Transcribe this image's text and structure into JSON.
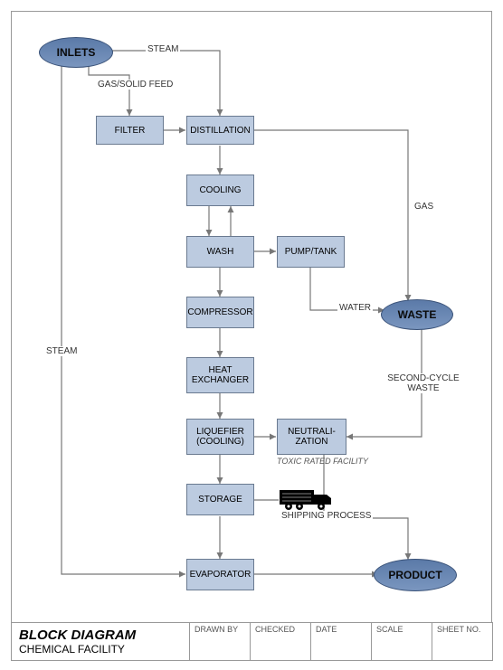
{
  "title": {
    "main": "BLOCK DIAGRAM",
    "sub": "CHEMICAL FACILITY"
  },
  "footer": {
    "drawn": "DRAWN BY",
    "checked": "CHECKED",
    "date": "DATE",
    "scale": "SCALE",
    "sheet": "SHEET NO."
  },
  "nodes": {
    "inlets": "INLETS",
    "filter": "FILTER",
    "distillation": "DISTILLATION",
    "cooling": "COOLING",
    "wash": "WASH",
    "pumptank": "PUMP/TANK",
    "compressor": "COMPRESSOR",
    "heat_exchanger": "HEAT EXCHANGER",
    "liquefier": "LIQUEFIER (COOLING)",
    "neutralization": "NEUTRALI- ZATION",
    "storage": "STORAGE",
    "evaporator": "EVAPORATOR",
    "waste": "WASTE",
    "product": "PRODUCT"
  },
  "labels": {
    "steam_top": "STEAM",
    "gas_solid_feed": "GAS/SOLID FEED",
    "gas": "GAS",
    "water": "WATER",
    "second_cycle": "SECOND-CYCLE WASTE",
    "steam_left": "STEAM",
    "toxic": "TOXIC RATED FACILITY",
    "shipping": "SHIPPING PROCESS"
  }
}
